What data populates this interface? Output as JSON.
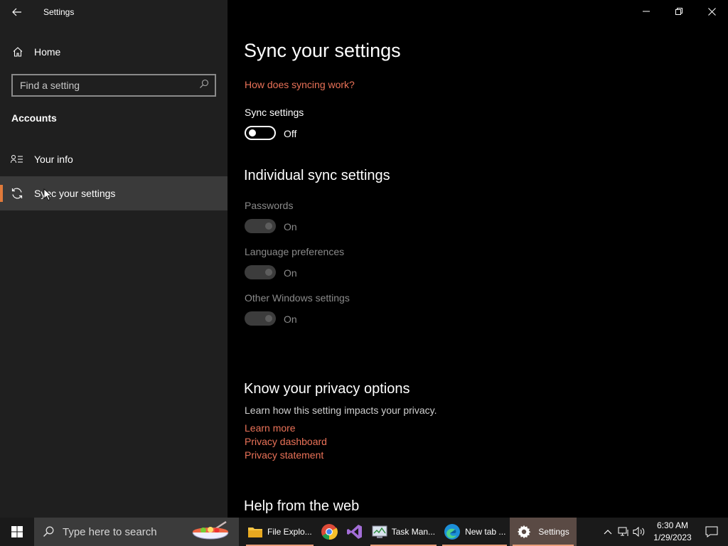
{
  "window": {
    "title": "Settings"
  },
  "sidebar": {
    "home_label": "Home",
    "search_placeholder": "Find a setting",
    "section": "Accounts",
    "items": [
      {
        "label": "Your info",
        "icon": "person-list-icon",
        "active": false
      },
      {
        "label": "Sync your settings",
        "icon": "sync-icon",
        "active": true
      }
    ]
  },
  "main": {
    "title": "Sync your settings",
    "how_link": "How does syncing work?",
    "sync_label": "Sync settings",
    "sync_state": "Off",
    "individual_heading": "Individual sync settings",
    "individual": [
      {
        "label": "Passwords",
        "state": "On"
      },
      {
        "label": "Language preferences",
        "state": "On"
      },
      {
        "label": "Other Windows settings",
        "state": "On"
      }
    ],
    "privacy_heading": "Know your privacy options",
    "privacy_text": "Learn how this setting impacts your privacy.",
    "privacy_links": [
      "Learn more",
      "Privacy dashboard",
      "Privacy statement"
    ],
    "help_heading": "Help from the web"
  },
  "taskbar": {
    "search_placeholder": "Type here to search",
    "apps": [
      {
        "label": "File Explo...",
        "icon": "folder-icon"
      },
      {
        "label": "",
        "icon": "chrome-icon"
      },
      {
        "label": "",
        "icon": "visual-studio-icon"
      },
      {
        "label": "Task Man...",
        "icon": "task-manager-icon"
      },
      {
        "label": "New tab ...",
        "icon": "edge-icon"
      },
      {
        "label": "Settings",
        "icon": "gear-icon"
      }
    ],
    "time": "6:30 AM",
    "date": "1/29/2023"
  },
  "colors": {
    "accent": "#ea7258",
    "sidebar_bg": "#1f1f1f",
    "active_item_bg": "#3a3a3a"
  }
}
